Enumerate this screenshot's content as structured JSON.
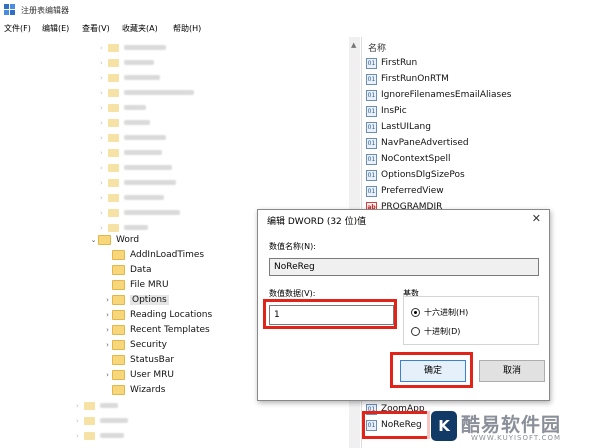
{
  "window": {
    "title": "注册表编辑器"
  },
  "menu": [
    "文件(F)",
    "编辑(E)",
    "查看(V)",
    "收藏夹(A)",
    "帮助(H)"
  ],
  "tree": {
    "word_label": "Word",
    "children": [
      {
        "label": "AddInLoadTimes",
        "arrow": ""
      },
      {
        "label": "Data",
        "arrow": ""
      },
      {
        "label": "File MRU",
        "arrow": ""
      },
      {
        "label": "Options",
        "arrow": "›",
        "selected": true
      },
      {
        "label": "Reading Locations",
        "arrow": "›"
      },
      {
        "label": "Recent Templates",
        "arrow": "›"
      },
      {
        "label": "Security",
        "arrow": "›"
      },
      {
        "label": "StatusBar",
        "arrow": ""
      },
      {
        "label": "User MRU",
        "arrow": "›"
      },
      {
        "label": "Wizards",
        "arrow": ""
      }
    ]
  },
  "values_pane": {
    "header": "名称",
    "values": [
      {
        "name": "FirstRun",
        "type": "dword"
      },
      {
        "name": "FirstRunOnRTM",
        "type": "dword"
      },
      {
        "name": "IgnoreFilenamesEmailAliases",
        "type": "dword"
      },
      {
        "name": "InsPic",
        "type": "dword"
      },
      {
        "name": "LastUILang",
        "type": "dword"
      },
      {
        "name": "NavPaneAdvertised",
        "type": "dword"
      },
      {
        "name": "NoContextSpell",
        "type": "dword"
      },
      {
        "name": "OptionsDlgSizePos",
        "type": "dword"
      },
      {
        "name": "PreferredView",
        "type": "dword"
      },
      {
        "name": "PROGRAMDIR",
        "type": "string"
      }
    ],
    "bottom_values": [
      {
        "name": "ZoomApp",
        "type": "dword"
      },
      {
        "name": "NoReReg",
        "type": "dword"
      }
    ]
  },
  "dialog": {
    "title": "编辑 DWORD (32 位)值",
    "value_name_label": "数值名称(N):",
    "value_name": "NoReReg",
    "value_data_label": "数值数据(V):",
    "value_data": "1",
    "base_label": "基数",
    "radio_hex": "十六进制(H)",
    "radio_dec": "十进制(D)",
    "selected_base": "hex",
    "ok": "确定",
    "cancel": "取消"
  },
  "watermark": {
    "text": "酷易软件园",
    "url": "WWW.KUYISOFT.COM",
    "logo_letter": "K"
  },
  "colors": {
    "highlight": "#e1231a",
    "folder": "#f7d77a"
  }
}
